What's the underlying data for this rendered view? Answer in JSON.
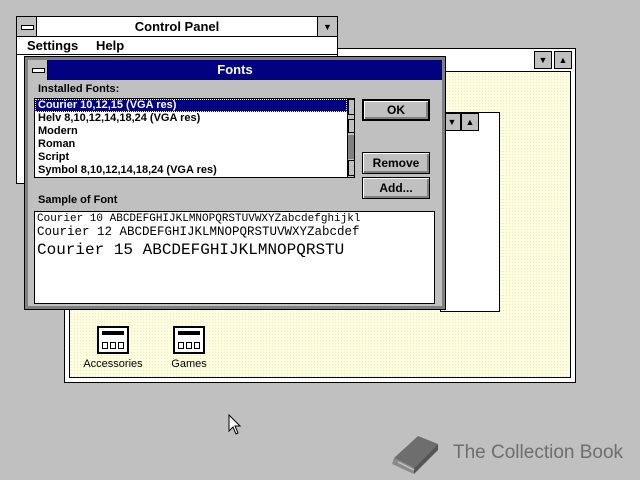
{
  "control_panel": {
    "title": "Control Panel",
    "menus": [
      "Settings",
      "Help"
    ]
  },
  "fonts_dialog": {
    "title": "Fonts",
    "installed_label": "Installed Fonts:",
    "fonts": [
      "Courier 10,12,15 (VGA res)",
      "Helv 8,10,12,14,18,24 (VGA res)",
      "Modern",
      "Roman",
      "Script",
      "Symbol 8,10,12,14,18,24 (VGA res)"
    ],
    "selected_index": 0,
    "buttons": {
      "ok": "OK",
      "remove": "Remove",
      "add": "Add..."
    },
    "sample_label": "Sample of Font",
    "samples": [
      "Courier 10  ABCDEFGHIJKLMNOPQRSTUVWXYZabcdefghijkl",
      "Courier 12  ABCDEFGHIJKLMNOPQRSTUVWXYZabcdef",
      "Courier 15  ABCDEFGHIJKLMNOPQRSTU"
    ]
  },
  "program_manager": {
    "groups": [
      "Accessories",
      "Games"
    ]
  },
  "watermark": {
    "text": "The Collection Book"
  },
  "colors": {
    "titlebar_active": "#000080",
    "desktop": "#c0c0c0",
    "window_bg": "#ffffe0"
  }
}
